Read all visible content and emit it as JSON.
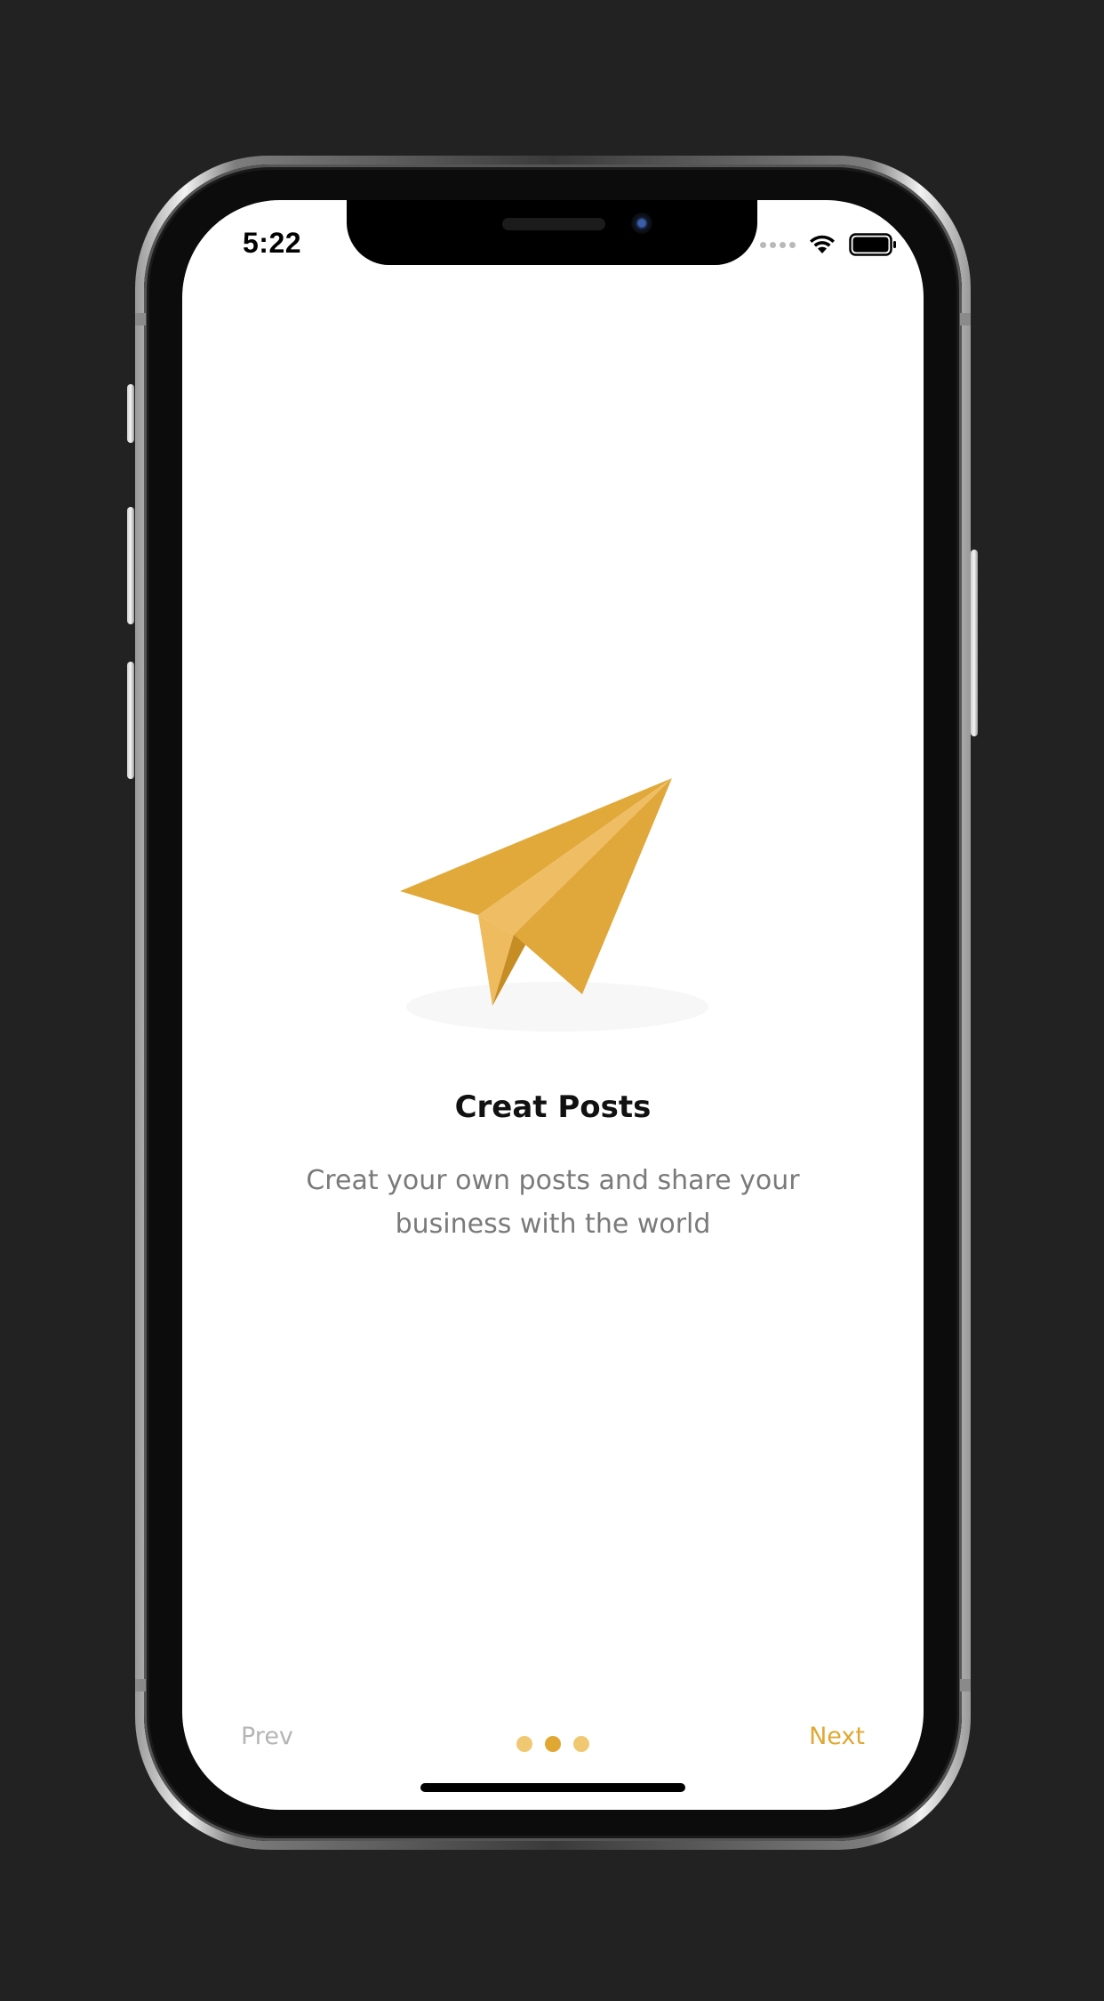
{
  "status_bar": {
    "time": "5:22"
  },
  "onboarding": {
    "title": "Creat Posts",
    "description": "Creat your own posts and share your business with the world",
    "illustration": "paper-plane-icon"
  },
  "navigation": {
    "prev_label": "Prev",
    "next_label": "Next",
    "page_count": 3,
    "active_page": 2
  },
  "colors": {
    "accent": "#E0A833",
    "accent_light": "#F0C872",
    "text_primary": "#111111",
    "text_secondary": "#7A7A7A",
    "disabled": "#B5B5B5",
    "background": "#FFFFFF",
    "frame_background": "#222222"
  }
}
